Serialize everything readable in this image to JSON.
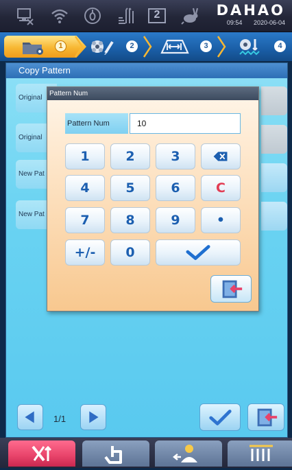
{
  "status": {
    "brand": "DAHAO",
    "time": "09:54",
    "date": "2020-06-04",
    "head_number": "2",
    "icons": [
      "monitor-network-icon",
      "wifi-icon",
      "hand-wheel-icon",
      "needle-speed-icon",
      "head-number-icon",
      "rabbit-speed-icon"
    ]
  },
  "steps": [
    {
      "num": "1",
      "icon": "folder-flower-icon",
      "active": true
    },
    {
      "num": "2",
      "icon": "flower-pen-icon",
      "active": false
    },
    {
      "num": "3",
      "icon": "frame-resize-icon",
      "active": false
    },
    {
      "num": "4",
      "icon": "embroidery-stitch-icon",
      "active": false
    }
  ],
  "main": {
    "title": "Copy Pattern",
    "fields": [
      {
        "label": "Original"
      },
      {
        "label": "Original"
      },
      {
        "label": "New Pat"
      },
      {
        "label": "New Pat"
      }
    ],
    "pager": "1/1"
  },
  "dialog": {
    "title": "Pattern Num",
    "field_label": "Pattern Num",
    "field_value": "10",
    "keys": {
      "k1": "1",
      "k2": "2",
      "k3": "3",
      "k4": "4",
      "k5": "5",
      "k6": "6",
      "clear": "C",
      "k7": "7",
      "k8": "8",
      "k9": "9",
      "dot": "•",
      "sign": "+/-",
      "k0": "0"
    }
  },
  "bottom_nav": [
    "needle-trim-icon",
    "manual-hand-icon",
    "operator-icon",
    "thread-needles-icon"
  ],
  "colors": {
    "accent": "#f7b733",
    "nav_active": "#e8436a",
    "key_text": "#1c5fb0",
    "clear_key": "#e23d54"
  }
}
